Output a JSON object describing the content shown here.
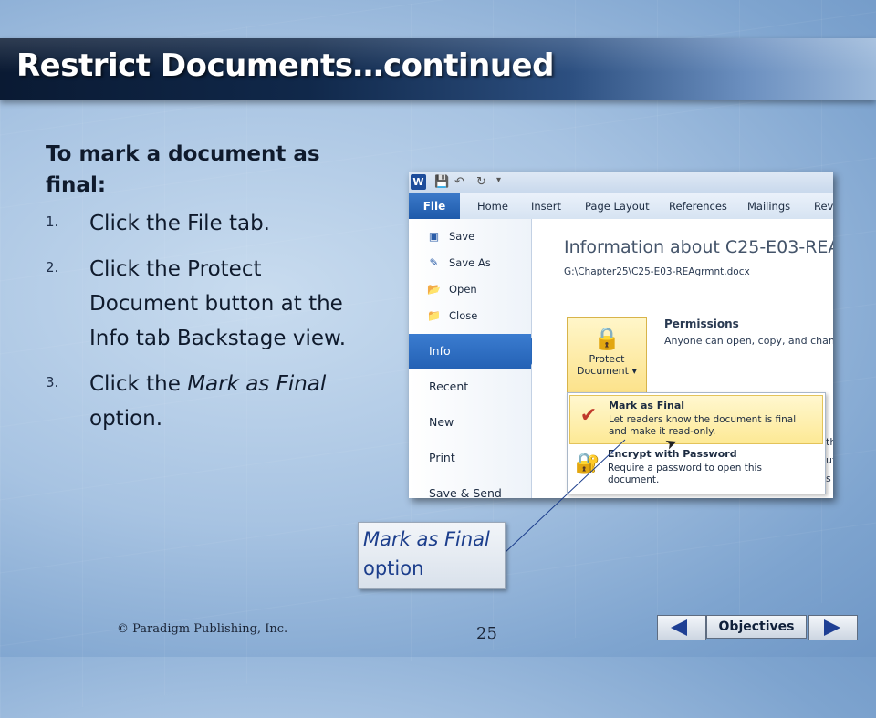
{
  "slide": {
    "title": "Restrict Documents…continued",
    "intro": "To mark a document as final:",
    "steps": [
      {
        "num": "1.",
        "html": "Click the File tab."
      },
      {
        "num": "2.",
        "html": "Click the Protect Document button at the Info tab Backstage view."
      },
      {
        "num": "3.",
        "html": "Click the <i>Mark as Final</i> option."
      }
    ]
  },
  "screenshot": {
    "app_icon_letter": "W",
    "ribbon_tabs": [
      "File",
      "Home",
      "Insert",
      "Page Layout",
      "References",
      "Mailings",
      "Revi"
    ],
    "nav_commands": [
      "Save",
      "Save As",
      "Open",
      "Close"
    ],
    "nav_tabs": [
      "Info",
      "Recent",
      "New",
      "Print",
      "Save & Send"
    ],
    "info_heading": "Information about C25-E03-REA",
    "info_path": "G:\\Chapter25\\C25-E03-REAgrmnt.docx",
    "protect_button": {
      "line1": "Protect",
      "line2": "Document ▾"
    },
    "permissions": {
      "title": "Permissions",
      "desc": "Anyone can open, copy, and chan"
    },
    "side_fragments": [
      "th",
      "ut",
      "s"
    ],
    "menu_items": [
      {
        "title": "Mark as Final",
        "desc": "Let readers know the document is final and make it read-only."
      },
      {
        "title": "Encrypt with Password",
        "desc": "Require a password to open this document."
      }
    ]
  },
  "callout": {
    "line1": "Mark as Final",
    "line2": "option"
  },
  "footer": {
    "copyright": "© Paradigm Publishing, Inc.",
    "page_number": "25",
    "objectives_label": "Objectives"
  },
  "icons": {
    "save": "save-icon",
    "save_as": "save-as-icon",
    "open": "open-folder-icon",
    "close": "close-document-icon",
    "protect": "lock-key-icon",
    "mark_final": "mark-final-icon",
    "encrypt": "encrypt-lock-icon",
    "prev": "previous-arrow-icon",
    "next": "next-arrow-icon"
  },
  "colors": {
    "title_bar_dark": "#0a1a33",
    "file_tab": "#2462b5",
    "highlight": "#fde995",
    "callout_text": "#1c3e8c"
  }
}
